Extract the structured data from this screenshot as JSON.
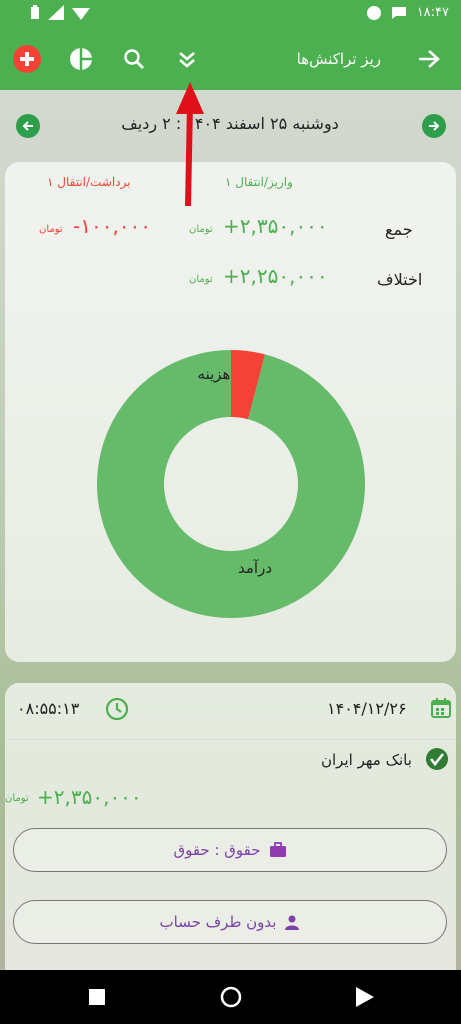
{
  "status_bar": {
    "time": "۱۸:۴۷"
  },
  "app_bar": {
    "title": "ریز تراکنش‌ها"
  },
  "date_bar": {
    "text": "دوشنبه ۲۵ اسفند ۱۴۰۴ : ۲ ردیف"
  },
  "summary": {
    "deposit_count_label": "۱ واریز/انتقال",
    "withdraw_count_label": "۱ برداشت/انتقال",
    "total_label": "جمع",
    "total_deposit": "+۲,۳۵۰,۰۰۰",
    "total_withdraw": "-۱۰۰,۰۰۰",
    "difference_label": "اختلاف",
    "difference_value": "+۲,۲۵۰,۰۰۰",
    "currency": "تومان"
  },
  "chart_data": {
    "type": "pie",
    "labels": [
      "درآمد",
      "هزینه"
    ],
    "values": [
      2350000,
      100000
    ],
    "colors": [
      "#66bb6a",
      "#f44336"
    ]
  },
  "transaction": {
    "date": "۱۴۰۴/۱۲/۲۶",
    "time": "۰۸:۵۵:۱۳",
    "bank": "بانک مهر ایران",
    "amount": "+۲,۳۵۰,۰۰۰",
    "currency": "تومان",
    "category": "حقوق : حقوق",
    "account": "بدون طرف حساب"
  },
  "annotation": {
    "arrow_color": "#e0101a"
  }
}
